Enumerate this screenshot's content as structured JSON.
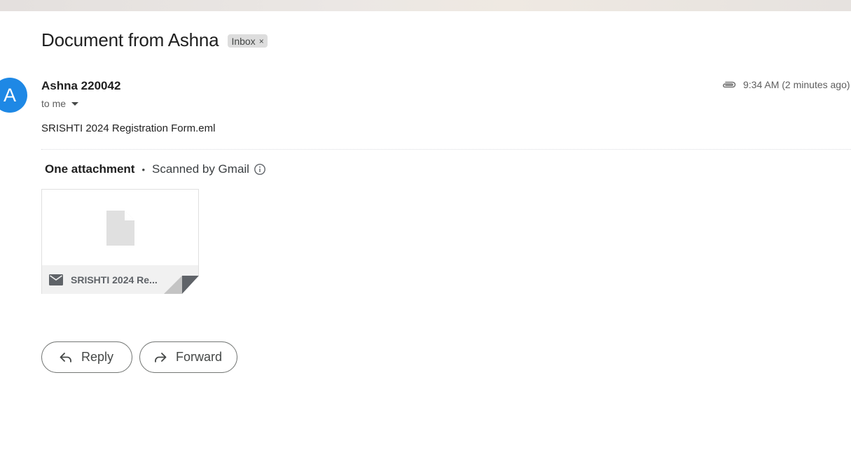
{
  "email": {
    "subject": "Document from Ashna",
    "label": "Inbox",
    "label_remove": "×",
    "sender": {
      "avatar_letter": "A",
      "name": "Ashna 220042",
      "recipient": "to me"
    },
    "time": "9:34 AM (2 minutes ago)",
    "body": "SRISHTI 2024 Registration Form.eml"
  },
  "attachments": {
    "count_label": "One attachment",
    "separator": "•",
    "scan_label": "Scanned by Gmail",
    "items": [
      {
        "name": "SRISHTI 2024 Re...",
        "icon": "mail-icon"
      }
    ]
  },
  "actions": {
    "reply": "Reply",
    "forward": "Forward"
  },
  "colors": {
    "avatar": "#1e88e5",
    "label_chip": "#dddddd"
  }
}
